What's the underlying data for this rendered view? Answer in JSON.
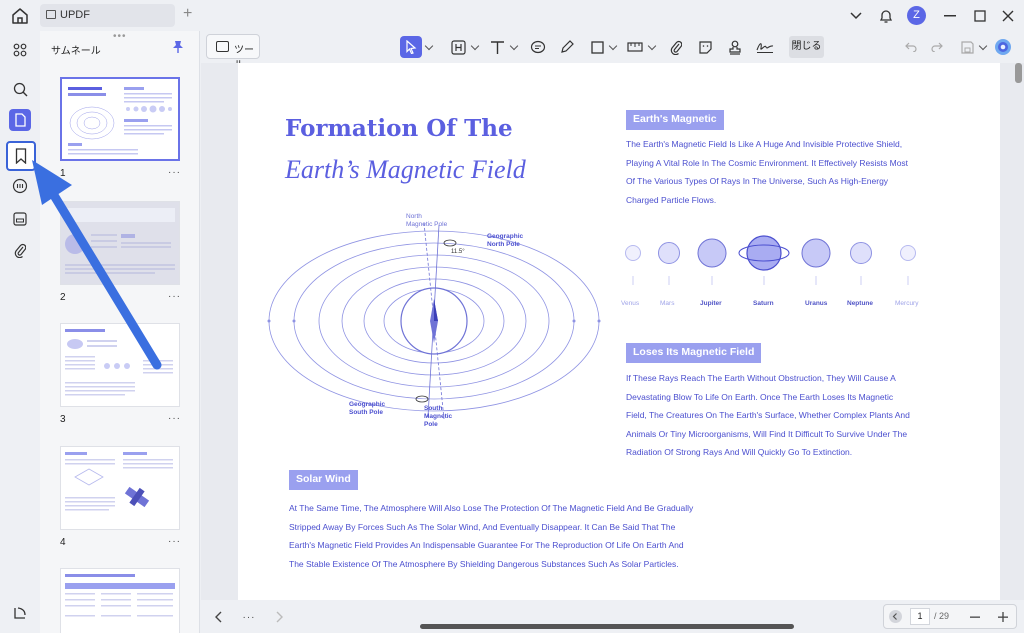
{
  "app": {
    "tab_title": "UPDF",
    "avatar_letter": "Z"
  },
  "sidebar": {
    "panel_title": "サムネール",
    "pages": [
      {
        "number": "1",
        "more": "···"
      },
      {
        "number": "2",
        "more": "···"
      },
      {
        "number": "3",
        "more": "···"
      },
      {
        "number": "4",
        "more": "···"
      }
    ]
  },
  "toolbar": {
    "tools_label": "ツール",
    "close_label": "閉じる"
  },
  "document": {
    "title_line1": "Formation Of The",
    "title_line2": "Earth’s Magnetic Field",
    "diagram": {
      "north_magnetic_pole": [
        "North",
        "Magnetic Pole"
      ],
      "geographic_north_pole": [
        "Geographic",
        "North Pole"
      ],
      "angle": "11.5°",
      "geographic_south_pole": [
        "Geographic",
        "South Pole"
      ],
      "south_magnetic_pole": [
        "South",
        "Magnetic",
        "Pole"
      ]
    },
    "section1": {
      "label": "Earth's Magnetic",
      "lines": [
        "The Earth's Magnetic Field Is Like A Huge And Invisible Protective Shield,",
        "Playing A Vital Role In The Cosmic Environment. It Effectively Resists Most",
        "Of The Various Types Of Rays In The Universe, Such As High-Energy",
        "Charged Particle Flows."
      ]
    },
    "planets": [
      "Venus",
      "Mars",
      "Jupiter",
      "Saturn",
      "Uranus",
      "Neptune",
      "Mercury"
    ],
    "section2": {
      "label": "Loses Its Magnetic Field",
      "lines": [
        "If These Rays Reach The Earth Without Obstruction, They Will Cause A",
        "Devastating Blow To Life On Earth. Once The Earth Loses Its Magnetic",
        "Field, The Creatures On The Earth's Surface, Whether Complex Plants And",
        "Animals Or Tiny Microorganisms, Will Find It Difficult To Survive Under The",
        "Radiation Of Strong Rays And Will Quickly Go To Extinction."
      ]
    },
    "section3": {
      "label": "Solar Wind",
      "lines": [
        "At The Same Time, The Atmosphere Will Also Lose The Protection Of The Magnetic Field And Be Gradually",
        "Stripped Away By Forces Such As The Solar Wind, And Eventually Disappear. It Can Be Said That The",
        "Earth's Magnetic Field Provides An Indispensable Guarantee For The Reproduction Of Life On Earth And",
        "The Stable Existence Of The Atmosphere By Shielding Dangerous Substances Such As Solar Particles."
      ]
    }
  },
  "bottombar": {
    "more": "···",
    "current_page": "1",
    "total_pages": "/ 29"
  },
  "colors": {
    "accent": "#5b67e6",
    "doc_blue": "#5b5fe0",
    "label_bg": "#9aa0ef",
    "annotation_arrow": "#3a6fe0"
  }
}
